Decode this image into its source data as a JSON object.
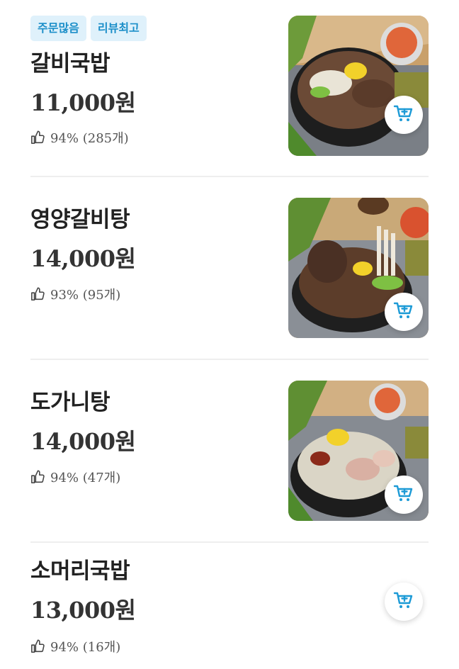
{
  "menu_items": [
    {
      "badges": [
        "주문많음",
        "리뷰최고"
      ],
      "name": "갈비국밥",
      "price": "11,000원",
      "rating": "94% (285개)",
      "has_photo": true
    },
    {
      "badges": [],
      "name": "영양갈비탕",
      "price": "14,000원",
      "rating": "93% (95개)",
      "has_photo": true
    },
    {
      "badges": [],
      "name": "도가니탕",
      "price": "14,000원",
      "rating": "94% (47개)",
      "has_photo": true
    },
    {
      "badges": [],
      "name": "소머리국밥",
      "price": "13,000원",
      "rating": "94% (16개)",
      "has_photo": false
    }
  ],
  "icons": {
    "thumb": "thumbs-up-icon",
    "cart": "add-to-cart-icon"
  },
  "colors": {
    "accent": "#1c9ad6",
    "badge_bg": "#dff1fb",
    "divider": "#eeeeee"
  }
}
